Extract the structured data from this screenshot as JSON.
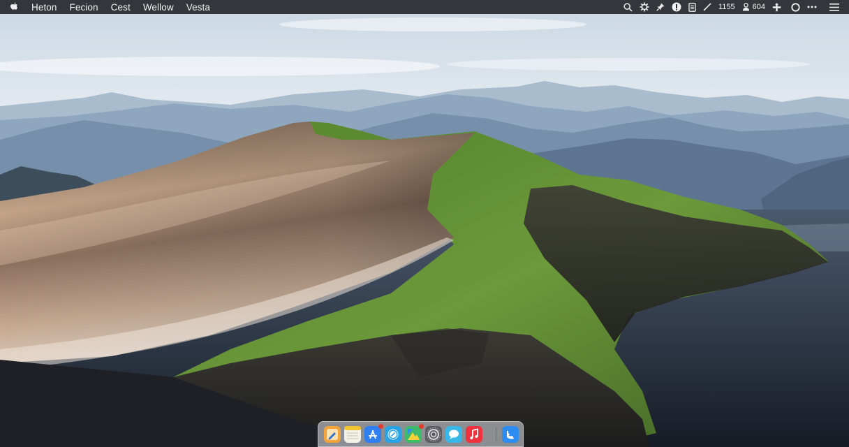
{
  "menu_bar": {
    "apple_menu_icon": "apple-icon",
    "items": [
      {
        "label": "Heton"
      },
      {
        "label": "Fecion"
      },
      {
        "label": "Cest"
      },
      {
        "label": "Wellow"
      },
      {
        "label": "Vesta"
      }
    ],
    "status": {
      "icons": [
        "search-icon",
        "gear-icon",
        "pin-icon",
        "info-circle-icon",
        "document-icon",
        "pen-icon"
      ],
      "value_a": "1155",
      "value_b": "604",
      "trailing_icons": [
        "plus-cross-icon",
        "circle-icon",
        "more-icon",
        "hamburger-menu-icon"
      ]
    }
  },
  "dock": {
    "apps": [
      {
        "icon": "pencil-app-icon",
        "color": "#f2a33a"
      },
      {
        "icon": "notes-icon",
        "color": "#f4f1e8"
      },
      {
        "icon": "app-store-icon",
        "color": "#2f7ff0",
        "badge": true
      },
      {
        "icon": "safari-icon",
        "color": "#2aa3e6"
      },
      {
        "icon": "photos-icon",
        "color": "#3dbb6a",
        "badge": true
      },
      {
        "icon": "settings-icon",
        "color": "#5c5c62"
      },
      {
        "icon": "messages-icon",
        "color": "#39b8e8"
      },
      {
        "icon": "music-icon",
        "color": "#f0323f"
      },
      {
        "icon": "finder-icon",
        "color": "#2d8cf0"
      }
    ]
  },
  "colors": {
    "menu_bar_bg": "#26282c",
    "sky_top": "#e9eef3",
    "mountain_blue": "#7d97b2",
    "dune_sand": "#b89a82",
    "grass": "#5f8a34",
    "water": "#1d2330"
  }
}
